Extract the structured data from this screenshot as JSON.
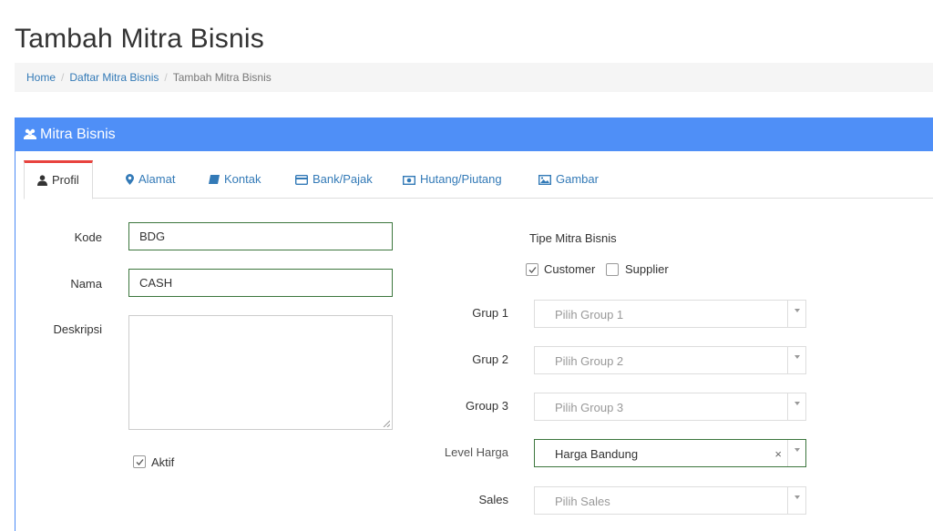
{
  "page": {
    "title": "Tambah Mitra Bisnis"
  },
  "breadcrumb": {
    "home": "Home",
    "list": "Daftar Mitra Bisnis",
    "current": "Tambah Mitra Bisnis"
  },
  "panel": {
    "title": "Mitra Bisnis",
    "accent": "#4f8ff7"
  },
  "tabs": [
    {
      "label": "Profil",
      "icon": "user-icon"
    },
    {
      "label": "Alamat",
      "icon": "map-marker-icon"
    },
    {
      "label": "Kontak",
      "icon": "book-icon"
    },
    {
      "label": "Bank/Pajak",
      "icon": "credit-card-icon"
    },
    {
      "label": "Hutang/Piutang",
      "icon": "money-icon"
    },
    {
      "label": "Gambar",
      "icon": "image-icon"
    }
  ],
  "form": {
    "kode": {
      "label": "Kode",
      "value": "BDG"
    },
    "nama": {
      "label": "Nama",
      "value": "CASH"
    },
    "deskripsi": {
      "label": "Deskripsi",
      "value": ""
    },
    "aktif": {
      "label": "Aktif",
      "checked": true
    },
    "tipe": {
      "title": "Tipe Mitra Bisnis",
      "customer": {
        "label": "Customer",
        "checked": true
      },
      "supplier": {
        "label": "Supplier",
        "checked": false
      }
    },
    "grup1": {
      "label": "Grup 1",
      "placeholder": "Pilih Group 1"
    },
    "grup2": {
      "label": "Grup 2",
      "placeholder": "Pilih Group 2"
    },
    "group3": {
      "label": "Group 3",
      "placeholder": "Pilih Group 3"
    },
    "level_harga": {
      "label": "Level Harga",
      "value": "Harga Bandung",
      "clear": "×"
    },
    "sales": {
      "label": "Sales",
      "placeholder": "Pilih Sales"
    }
  }
}
